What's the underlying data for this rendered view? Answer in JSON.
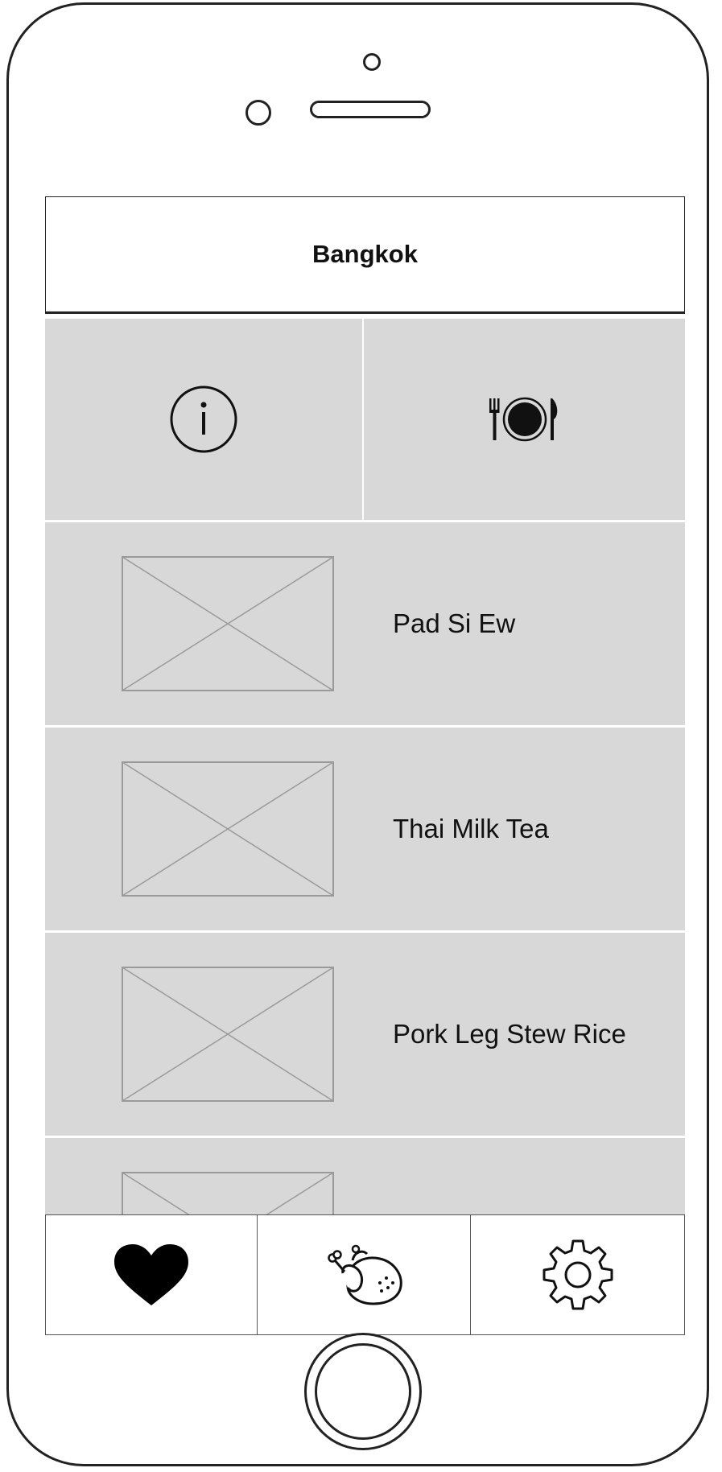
{
  "header": {
    "title": "Bangkok"
  },
  "top_tabs": [
    {
      "icon": "info-icon"
    },
    {
      "icon": "plate-cutlery-icon"
    }
  ],
  "dishes": [
    {
      "name": "Pad Si Ew",
      "image": "image-placeholder"
    },
    {
      "name": "Thai Milk Tea",
      "image": "image-placeholder"
    },
    {
      "name": "Pork Leg Stew Rice",
      "image": "image-placeholder"
    },
    {
      "name": "",
      "image": "image-placeholder"
    }
  ],
  "tab_bar": [
    {
      "icon": "heart-icon"
    },
    {
      "icon": "chicken-icon"
    },
    {
      "icon": "gear-icon"
    }
  ],
  "colors": {
    "panel": "#d8d8d8",
    "outline": "#222222",
    "placeholder_line": "#9a9a9a"
  }
}
